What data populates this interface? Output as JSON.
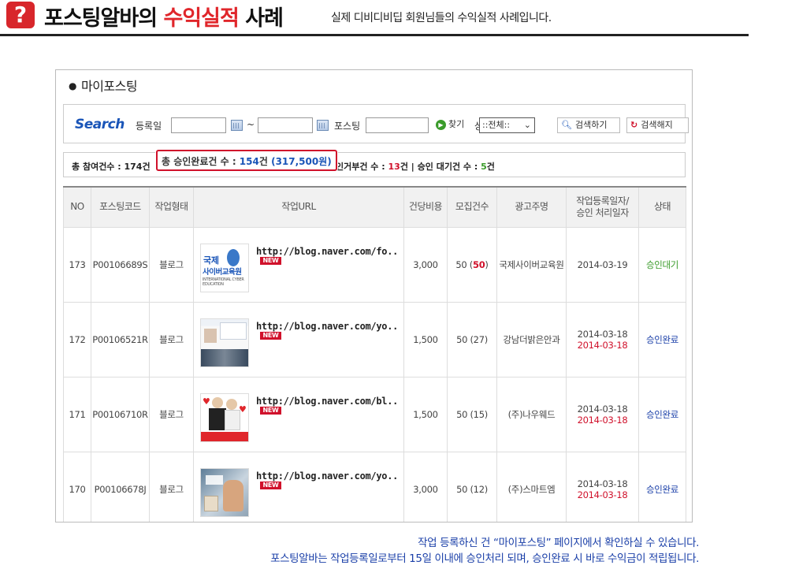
{
  "header": {
    "title_a": "포스팅알바의 ",
    "title_b": "수익실적",
    "title_c": " 사례",
    "subtitle": "실제 디비디비딥 회원님들의 수익실적 사례입니다.",
    "accent": "#e0262b"
  },
  "section": {
    "title": "마이포스팅"
  },
  "search": {
    "label": "Search",
    "date_label": "등록일",
    "tilde": "~",
    "posting_label": "포스팅",
    "find_label": "찾기",
    "status_label": "상태",
    "status_selected": "::전체::",
    "search_button": "검색하기",
    "reset_button": "검색해지"
  },
  "stats": {
    "participate_label": "총 참여건수 : ",
    "participate_value": "174",
    "unit": "건",
    "approved_label": "총 승인완료건 수 : ",
    "approved_value": "154",
    "approved_amount": "(317,500원)",
    "rejected_label": "인거부건 수 : ",
    "rejected_value": "13",
    "waiting_label": "| 승인 대기건 수 : ",
    "waiting_value": "5"
  },
  "table": {
    "headers": {
      "no": "NO",
      "code": "포스팅코드",
      "type": "작업형태",
      "url": "작업URL",
      "cost": "건당비용",
      "count": "모집건수",
      "advertiser": "광고주명",
      "date_a": "작업등록일자/",
      "date_b": "승인 처리일자",
      "status": "상태"
    },
    "new_badge": "NEW",
    "rows": [
      {
        "no": "173",
        "code": "P00106689S",
        "type": "블로그",
        "url": "http://blog.naver.com/fo..",
        "cost": "3,000",
        "count": "50",
        "count_paren": "50",
        "advertiser": "국제사이버교육원",
        "date": "2014-03-19",
        "date2": "",
        "status": "승인대기"
      },
      {
        "no": "172",
        "code": "P00106521R",
        "type": "블로그",
        "url": "http://blog.naver.com/yo..",
        "cost": "1,500",
        "count": "50",
        "count_paren": "27",
        "advertiser": "강남더밝은안과",
        "date": "2014-03-18",
        "date2": "2014-03-18",
        "status": "승인완료"
      },
      {
        "no": "171",
        "code": "P00106710R",
        "type": "블로그",
        "url": "http://blog.naver.com/bl..",
        "cost": "1,500",
        "count": "50",
        "count_paren": "15",
        "advertiser": "(주)나우웨드",
        "date": "2014-03-18",
        "date2": "2014-03-18",
        "status": "승인완료"
      },
      {
        "no": "170",
        "code": "P00106678J",
        "type": "블로그",
        "url": "http://blog.naver.com/yo..",
        "cost": "3,000",
        "count": "50",
        "count_paren": "12",
        "advertiser": "(주)스마트엠",
        "date": "2014-03-18",
        "date2": "2014-03-18",
        "status": "승인완료"
      }
    ],
    "thumb1_text_a": "국제",
    "thumb1_text_b": "사이버교육원",
    "thumb1_text_c": "INTERNATIONAL CYBER EDUCATION"
  },
  "footer": {
    "line1": "작업 등록하신 건 “마이포스팅” 페이지에서 확인하실 수 있습니다.",
    "line2": "포스팅알바는 작업등록일로부터 15일 이내에 승인처리 되며, 승인완료 시 바로 수익금이 적립됩니다."
  }
}
